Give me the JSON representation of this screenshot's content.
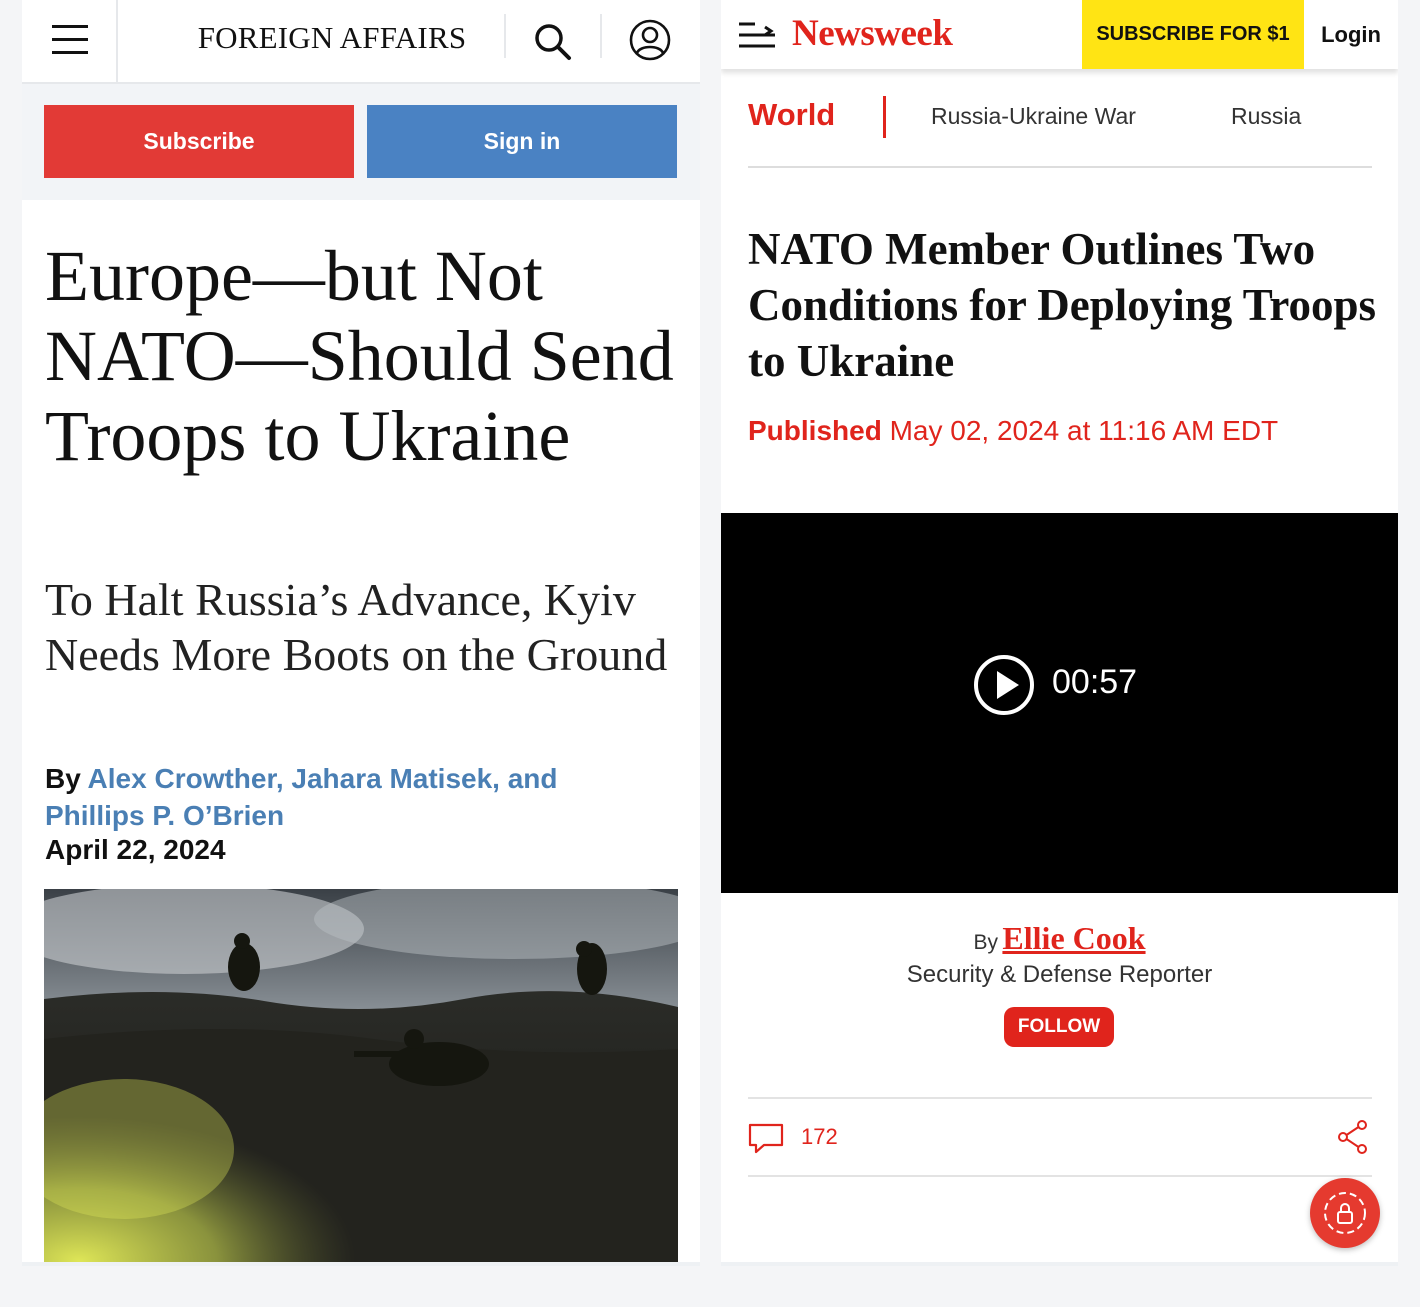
{
  "foreign_affairs": {
    "logo": "FOREIGN AFFAIRS",
    "subscribe_label": "Subscribe",
    "signin_label": "Sign in",
    "title": "Europe—but Not NATO—Should Send Troops to Ukraine",
    "subtitle": "To Halt Russia’s Advance, Kyiv Needs More Boots on the Ground",
    "byline_prefix": "By ",
    "byline_authors_1": "Alex Crowther, Jahara Matisek, and",
    "byline_authors_2": "Phillips P. O’Brien",
    "date": "April 22, 2024",
    "colors": {
      "subscribe": "#e23a36",
      "signin": "#4a82c3",
      "link": "#4a7fb4"
    },
    "icons": [
      "hamburger-menu-icon",
      "search-icon",
      "account-icon"
    ]
  },
  "newsweek": {
    "logo": "Newsweek",
    "subscribe_label": "SUBSCRIBE FOR $1",
    "login_label": "Login",
    "nav": {
      "primary": "World",
      "items": [
        "Russia-Ukraine War",
        "Russia"
      ]
    },
    "title": "NATO Member Outlines Two Conditions for Deploying Troops to Ukraine",
    "published_label": "Published",
    "published_date": "May 02, 2024 at 11:16 AM EDT",
    "video_duration": "00:57",
    "author_prefix": "By",
    "author_name": "Ellie Cook",
    "author_role": "Security & Defense Reporter",
    "follow_label": "FOLLOW",
    "comment_count": "172",
    "colors": {
      "brand": "#e0241c",
      "subscribe_bg": "#ffe414"
    },
    "icons": [
      "menu-icon",
      "play-icon",
      "comment-icon",
      "share-icon",
      "lock-icon"
    ]
  }
}
